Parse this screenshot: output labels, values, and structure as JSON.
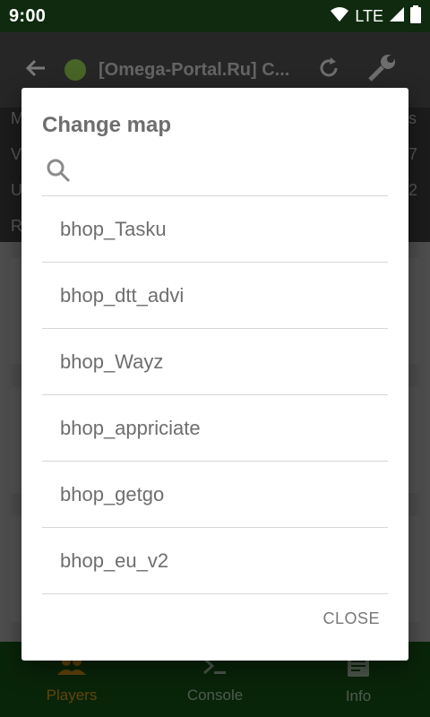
{
  "status_bar": {
    "time": "9:00",
    "network": "LTE"
  },
  "app_bar": {
    "title": "[Omega-Portal.Ru] C..."
  },
  "background_rows": [
    "M",
    "V",
    "U",
    "R"
  ],
  "background_right": [
    "s",
    "7",
    "2"
  ],
  "bottom_nav": {
    "items": [
      {
        "label": "Players",
        "active": true
      },
      {
        "label": "Console",
        "active": false
      },
      {
        "label": "Info",
        "active": false
      }
    ]
  },
  "dialog": {
    "title": "Change map",
    "search": {
      "value": "",
      "placeholder": ""
    },
    "maps": [
      "bhop_Tasku",
      "bhop_dtt_advi",
      "bhop_Wayz",
      "bhop_appriciate",
      "bhop_getgo",
      "bhop_eu_v2"
    ],
    "close_label": "CLOSE"
  },
  "colors": {
    "status_bar": "#0f2a0f",
    "bottom_nav": "#0f3a0f",
    "active_nav": "#9a6a12",
    "server_online": "#7cc342"
  }
}
